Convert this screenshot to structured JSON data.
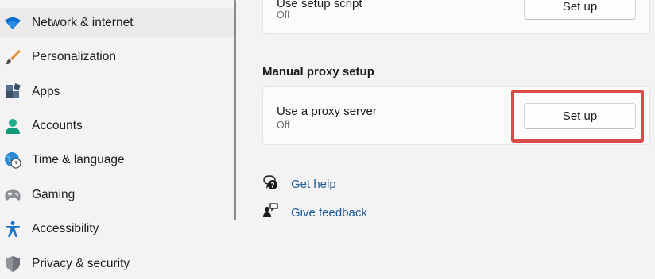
{
  "sidebar": {
    "items": [
      {
        "label": "Network & internet",
        "icon": "wifi-icon",
        "selected": true
      },
      {
        "label": "Personalization",
        "icon": "brush-icon"
      },
      {
        "label": "Apps",
        "icon": "apps-icon"
      },
      {
        "label": "Accounts",
        "icon": "person-icon"
      },
      {
        "label": "Time & language",
        "icon": "globe-clock-icon"
      },
      {
        "label": "Gaming",
        "icon": "gamepad-icon"
      },
      {
        "label": "Accessibility",
        "icon": "accessibility-icon"
      },
      {
        "label": "Privacy & security",
        "icon": "shield-icon"
      }
    ]
  },
  "script_setting": {
    "title": "Use setup script",
    "status": "Off",
    "button_label": "Set up"
  },
  "manual_proxy": {
    "section_title": "Manual proxy setup",
    "title": "Use a proxy server",
    "status": "Off",
    "button_label": "Set up"
  },
  "links": {
    "get_help": "Get help",
    "give_feedback": "Give feedback"
  },
  "colors": {
    "accent": "#0067c0",
    "link": "#1f5a96",
    "highlight": "#d84b4b"
  }
}
